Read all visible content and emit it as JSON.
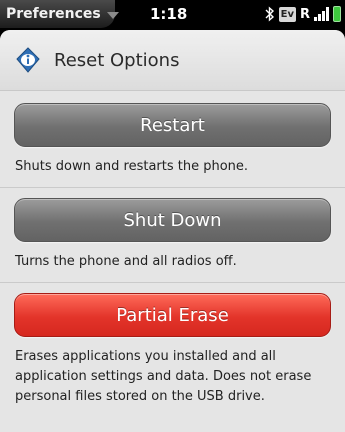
{
  "statusbar": {
    "app_name": "Preferences",
    "time": "1:18",
    "ev_badge": "Ev",
    "roaming": "R"
  },
  "header": {
    "title": "Reset Options",
    "icon": "info-diamond-icon"
  },
  "options": [
    {
      "button_label": "Restart",
      "description": "Shuts down and restarts the phone.",
      "style": "gray"
    },
    {
      "button_label": "Shut Down",
      "description": "Turns the phone and all radios off.",
      "style": "gray"
    },
    {
      "button_label": "Partial Erase",
      "description": "Erases applications you installed and all application settings and data. Does not erase personal files stored on the USB drive.",
      "style": "red"
    }
  ],
  "colors": {
    "gray_button": "#707070",
    "red_button": "#e3342a",
    "battery": "#3ec83e"
  }
}
